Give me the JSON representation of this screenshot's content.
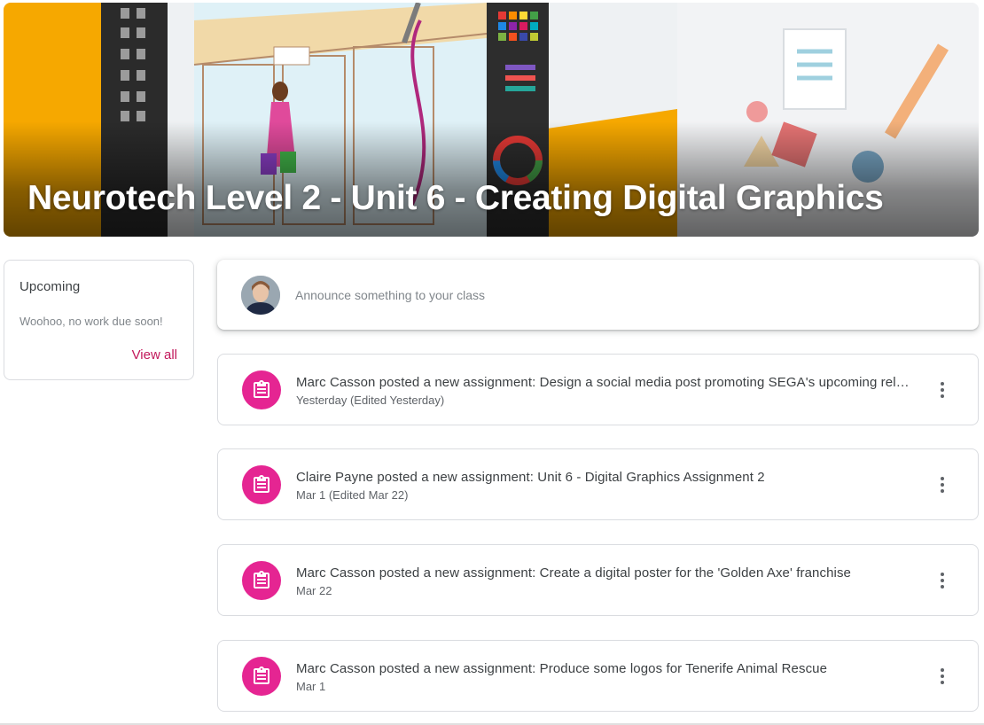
{
  "banner": {
    "title": "Neurotech Level 2 - Unit 6 - Creating Digital Graphics",
    "image_description_icons": [
      "shop-sign-icon",
      "palette-icon"
    ]
  },
  "upcoming": {
    "title": "Upcoming",
    "empty_message": "Woohoo, no work due soon!",
    "view_all_label": "View all"
  },
  "announce": {
    "placeholder": "Announce something to your class"
  },
  "stream": [
    {
      "title": "Marc Casson posted a new assignment: Design a social media post promoting SEGA's upcoming release",
      "date": "Yesterday (Edited Yesterday)"
    },
    {
      "title": "Claire Payne posted a new assignment: Unit 6 - Digital Graphics Assignment 2",
      "date": "Mar 1 (Edited Mar 22)"
    },
    {
      "title": "Marc Casson posted a new assignment: Create a digital poster for the 'Golden Axe' franchise",
      "date": "Mar 22"
    },
    {
      "title": "Marc Casson posted a new assignment: Produce some logos for Tenerife Animal Rescue",
      "date": "Mar 1"
    }
  ],
  "colors": {
    "accent": "#e52592",
    "link": "#c2185b",
    "text": "#3c4043",
    "secondary_text": "#5f6368"
  }
}
